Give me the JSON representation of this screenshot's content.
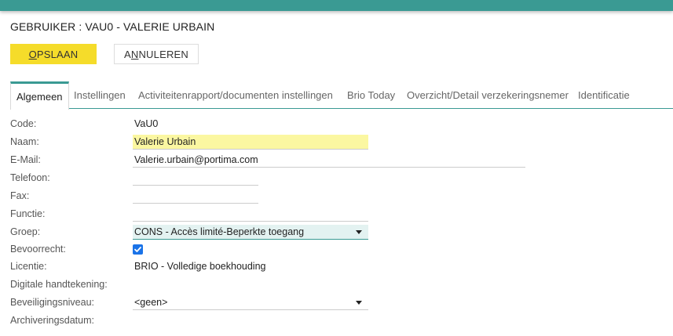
{
  "header": {
    "title": "GEBRUIKER : VAU0 - VALERIE URBAIN"
  },
  "toolbar": {
    "save": {
      "mnemonic": "O",
      "rest": "PSLAAN"
    },
    "cancel": {
      "before": "A",
      "mnemonic": "N",
      "rest": "NULEREN"
    }
  },
  "tabs": [
    {
      "label": "Algemeen",
      "active": true
    },
    {
      "label": "Instellingen"
    },
    {
      "label": "Activiteitenrapport/documenten instellingen"
    },
    {
      "label": "Brio Today"
    },
    {
      "label": "Overzicht/Detail verzekeringsnemer"
    },
    {
      "label": "Identificatie"
    }
  ],
  "form": {
    "code": {
      "label": "Code:",
      "value": "VaU0"
    },
    "naam": {
      "label": "Naam:",
      "value": "Valerie Urbain"
    },
    "email": {
      "label": "E-Mail:",
      "value": "Valerie.urbain@portima.com"
    },
    "telefoon": {
      "label": "Telefoon:",
      "value": ""
    },
    "fax": {
      "label": "Fax:",
      "value": ""
    },
    "functie": {
      "label": "Functie:",
      "value": ""
    },
    "groep": {
      "label": "Groep:",
      "value": "CONS - Accès limité-Beperkte toegang"
    },
    "bevoorrecht": {
      "label": "Bevoorrecht:",
      "checked": true
    },
    "licentie": {
      "label": "Licentie:",
      "value": "BRIO - Volledige boekhouding"
    },
    "digitale_handtekening": {
      "label": "Digitale handtekening:"
    },
    "beveiligingsniveau": {
      "label": "Beveiligingsniveau:",
      "value": "<geen>"
    },
    "archiveringsdatum": {
      "label": "Archiveringsdatum:"
    }
  },
  "colors": {
    "accent": "#3a9a93",
    "save_button": "#f5dc2a",
    "highlight_field": "#fbf7a1",
    "checkbox": "#1a73e8"
  }
}
